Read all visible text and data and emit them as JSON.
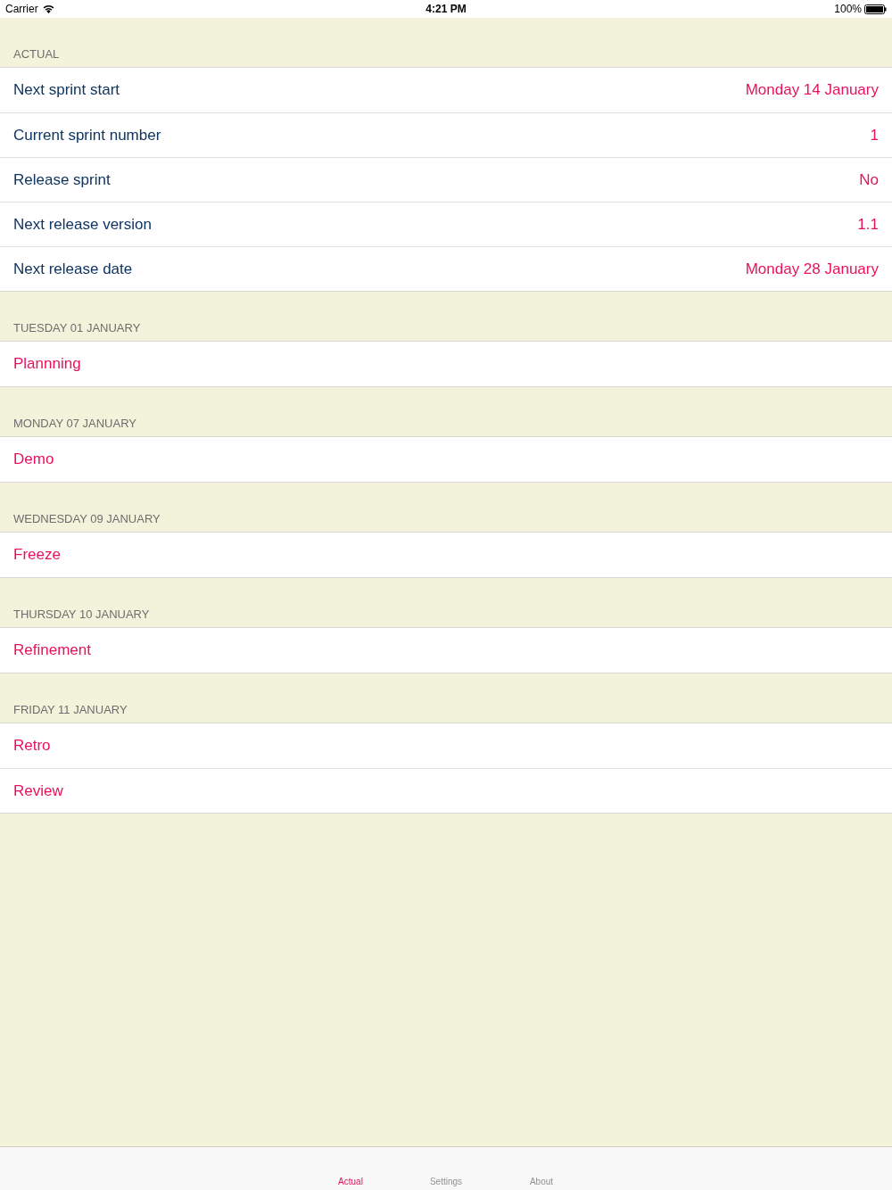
{
  "status_bar": {
    "carrier": "Carrier",
    "time": "4:21 PM",
    "battery": "100%"
  },
  "sections": [
    {
      "header": "ACTUAL",
      "rows": [
        {
          "kind": "detail",
          "label": "Next sprint start",
          "value": "Monday 14 January"
        },
        {
          "kind": "detail",
          "label": "Current sprint number",
          "value": "1"
        },
        {
          "kind": "detail",
          "label": "Release sprint",
          "value": "No"
        },
        {
          "kind": "detail",
          "label": "Next release version",
          "value": "1.1"
        },
        {
          "kind": "detail",
          "label": "Next release date",
          "value": "Monday 28 January"
        }
      ]
    },
    {
      "header": "TUESDAY 01 JANUARY",
      "rows": [
        {
          "kind": "event",
          "label": "Plannning"
        }
      ]
    },
    {
      "header": "MONDAY 07 JANUARY",
      "rows": [
        {
          "kind": "event",
          "label": "Demo"
        }
      ]
    },
    {
      "header": "WEDNESDAY 09 JANUARY",
      "rows": [
        {
          "kind": "event",
          "label": "Freeze"
        }
      ]
    },
    {
      "header": "THURSDAY 10 JANUARY",
      "rows": [
        {
          "kind": "event",
          "label": "Refinement"
        }
      ]
    },
    {
      "header": "FRIDAY 11 JANUARY",
      "rows": [
        {
          "kind": "event",
          "label": "Retro"
        },
        {
          "kind": "event",
          "label": "Review"
        }
      ]
    }
  ],
  "tabs": [
    {
      "label": "Actual",
      "selected": true
    },
    {
      "label": "Settings",
      "selected": false
    },
    {
      "label": "About",
      "selected": false
    }
  ]
}
